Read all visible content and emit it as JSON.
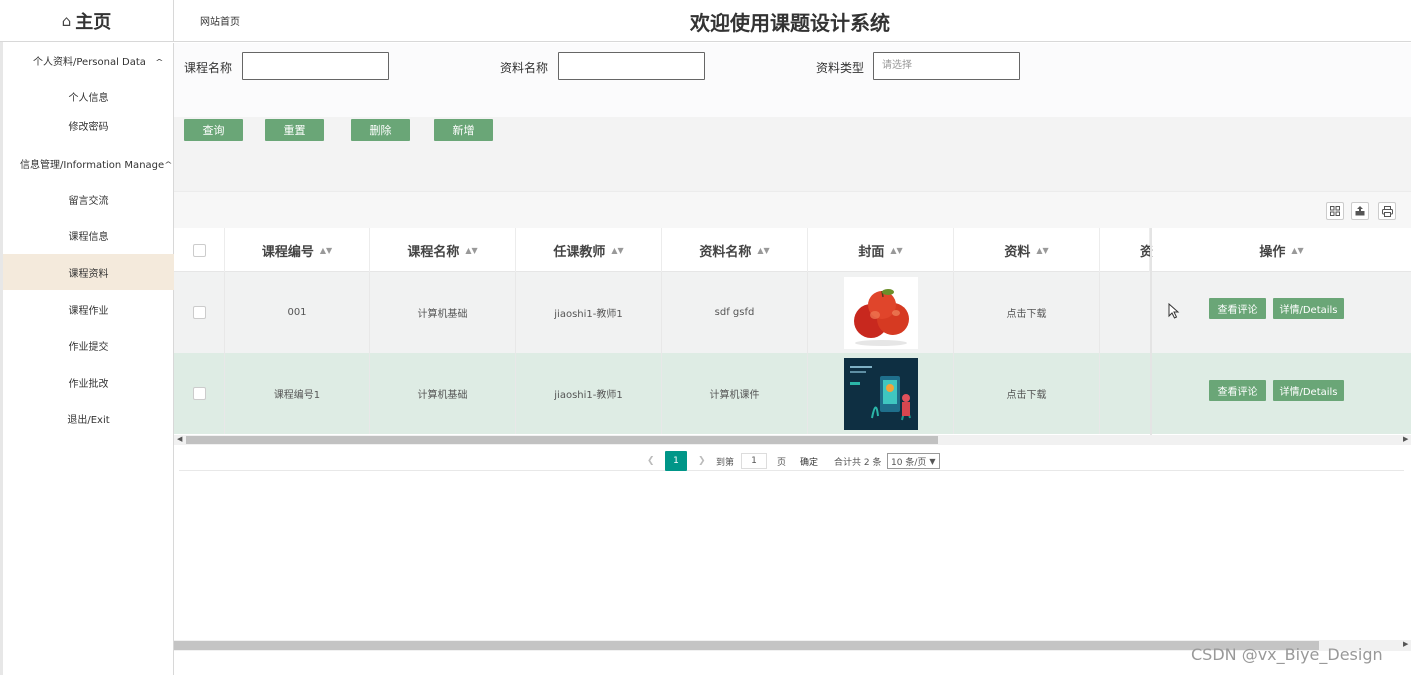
{
  "header": {
    "brand_title": "主页",
    "site_link": "网站首页",
    "system_title": "欢迎使用课题设计系统"
  },
  "sidebar": {
    "groups": [
      {
        "label": "个人资料/Personal Data",
        "chevron": "^",
        "items": [
          "个人信息",
          "修改密码"
        ]
      },
      {
        "label": "信息管理/Information Manage",
        "chevron": "^",
        "items": [
          "留言交流",
          "课程信息",
          "课程资料",
          "课程作业",
          "作业提交",
          "作业批改",
          "退出/Exit"
        ]
      }
    ],
    "active_item": "课程资料"
  },
  "search": {
    "fields": [
      {
        "label": "课程名称",
        "value": "",
        "placeholder": ""
      },
      {
        "label": "资料名称",
        "value": "",
        "placeholder": ""
      },
      {
        "label": "资料类型",
        "value": "",
        "placeholder": "请选择"
      }
    ],
    "buttons": [
      "查询",
      "重置",
      "删除",
      "新增"
    ]
  },
  "table": {
    "columns": [
      "课程编号",
      "课程名称",
      "任课教师",
      "资料名称",
      "封面",
      "资料",
      "资",
      "操作"
    ],
    "rows": [
      {
        "course_no": "001",
        "course_name": "计算机基础",
        "teacher": "jiaoshi1-教师1",
        "material_name": "sdf gsfd",
        "cover": "apples-image",
        "download": "点击下载"
      },
      {
        "course_no": "课程编号1",
        "course_name": "计算机基础",
        "teacher": "jiaoshi1-教师1",
        "material_name": "计算机课件",
        "cover": "slide-image",
        "download": "点击下载"
      }
    ],
    "row_actions": [
      "查看评论",
      "详情/Details"
    ]
  },
  "pagination": {
    "current_page": "1",
    "goto_label": "到第",
    "goto_value": "1",
    "page_unit": "页",
    "confirm": "确定",
    "total": "合计共 2 条",
    "page_size": "10 条/页"
  },
  "watermark": "CSDN @vx_Biye_Design",
  "colors": {
    "accent_green": "#6aa677",
    "pager_teal": "#009688",
    "active_bg": "#f4eadc"
  }
}
